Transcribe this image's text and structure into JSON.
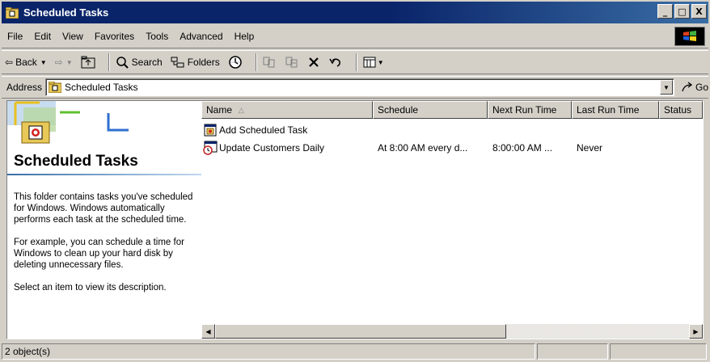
{
  "window": {
    "title": "Scheduled Tasks",
    "controls": {
      "minimize": "_",
      "maximize": "□",
      "close": "X"
    }
  },
  "menubar": [
    {
      "label": "File"
    },
    {
      "label": "Edit"
    },
    {
      "label": "View"
    },
    {
      "label": "Favorites"
    },
    {
      "label": "Tools"
    },
    {
      "label": "Advanced"
    },
    {
      "label": "Help"
    }
  ],
  "toolbar": {
    "back_label": "Back",
    "search_label": "Search",
    "folders_label": "Folders"
  },
  "address": {
    "label": "Address",
    "value": "Scheduled Tasks",
    "go_label": "Go"
  },
  "left_pane": {
    "title": "Scheduled Tasks",
    "paragraphs": [
      "This folder contains tasks you've scheduled for Windows. Windows automatically performs each task at the scheduled time.",
      "For example, you can schedule a time for Windows to clean up your hard disk by deleting unnecessary files.",
      "Select an item to view its description."
    ]
  },
  "list": {
    "columns": [
      "Name",
      "Schedule",
      "Next Run Time",
      "Last Run Time",
      "Status"
    ],
    "rows": [
      {
        "name": "Add Scheduled Task",
        "schedule": "",
        "next_run": "",
        "last_run": "",
        "status": ""
      },
      {
        "name": "Update Customers Daily",
        "schedule": "At 8:00 AM every d...",
        "next_run": "8:00:00 AM ...",
        "last_run": "Never",
        "status": ""
      }
    ]
  },
  "status": {
    "objects": "2 object(s)"
  },
  "colors": {
    "titlebar": "#0a246a",
    "face": "#d4d0c8"
  }
}
